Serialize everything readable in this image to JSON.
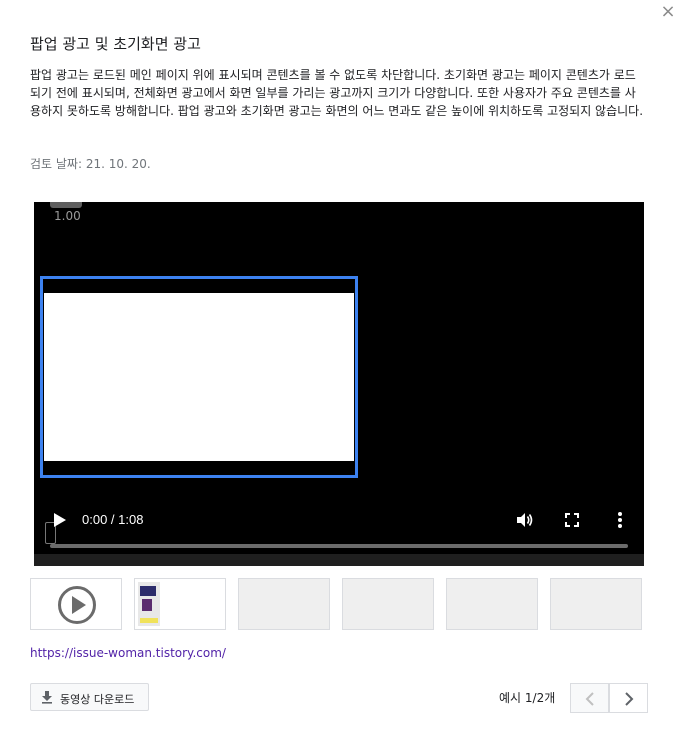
{
  "dialog": {
    "close_glyph": "×",
    "title": "팝업 광고 및 초기화면 광고",
    "description": "팝업 광고는 로드된 메인 페이지 위에 표시되며 콘텐츠를 볼 수 없도록 차단합니다. 초기화면 광고는 페이지 콘텐츠가 로드되기 전에 표시되며, 전체화면 광고에서 화면 일부를 가리는 광고까지 크기가 다양합니다. 또한 사용자가 주요 콘텐츠를 사용하지 못하도록 방해합니다. 팝업 광고와 초기화면 광고는 화면의 어느 면과도 같은 높이에 위치하도록 고정되지 않습니다.",
    "review_date": "검토 날짜: 21. 10. 20."
  },
  "video": {
    "zoom": "1.00",
    "time": "0:00 / 1:08",
    "progress": 0,
    "frame_color": "#3d82f0"
  },
  "thumbnails": [
    {
      "kind": "play",
      "icon": "play-circle-icon"
    },
    {
      "kind": "image"
    },
    {
      "kind": "empty"
    },
    {
      "kind": "empty"
    },
    {
      "kind": "empty"
    },
    {
      "kind": "empty"
    }
  ],
  "source_link": "https://issue-woman.tistory.com/",
  "footer": {
    "download_label": "동영상 다운로드",
    "pager_label": "예시 1/2개"
  },
  "colors": {
    "link": "#5223a8",
    "accent_border": "#3d82f0"
  }
}
